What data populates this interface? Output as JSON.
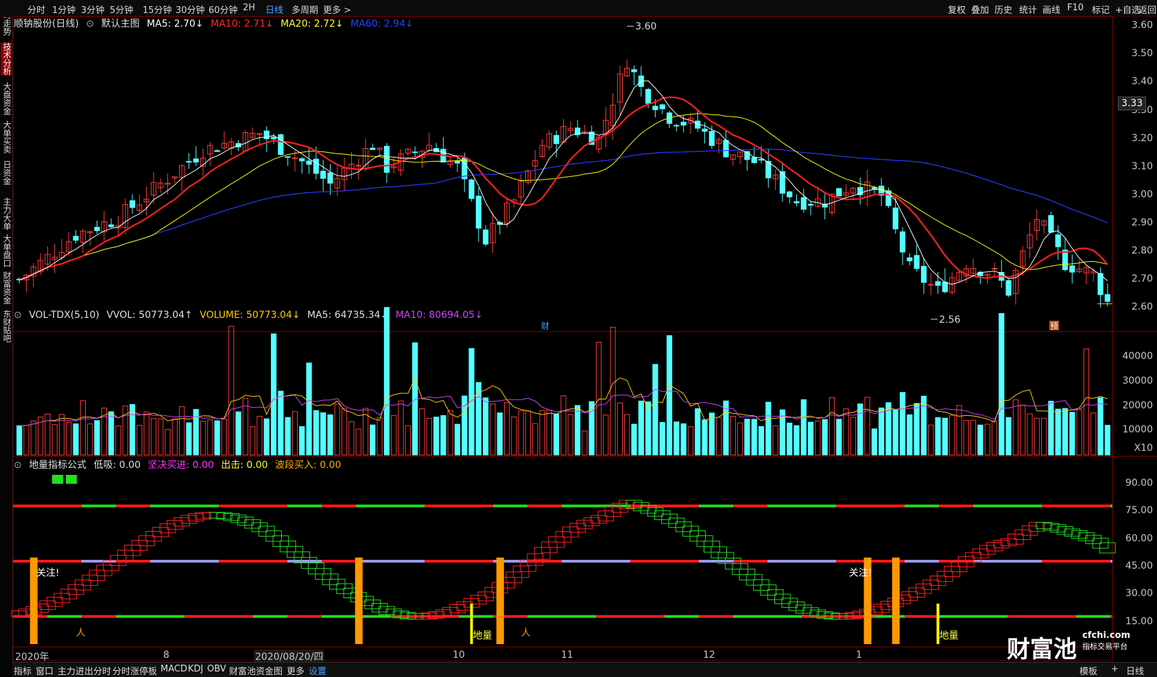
{
  "left_tabs": [
    "分时走势",
    "技术分析",
    "大盘资金",
    "大单买卖",
    "日资金",
    "主力大单",
    "大单盘口",
    "财富资金",
    "东财贴吧"
  ],
  "active_left_tab": 1,
  "periods": [
    "分时",
    "1分钟",
    "3分钟",
    "5分钟",
    "15分钟",
    "30分钟",
    "60分钟",
    "2H",
    "日线",
    "多周期",
    "更多 >"
  ],
  "active_period": "日线",
  "right_tools": [
    "复权",
    "叠加",
    "历史",
    "统计",
    "画线",
    "F10",
    "标记",
    "+自选",
    "返回"
  ],
  "stock": {
    "name": "顺钠股份(日线)",
    "main_chart": "默认主图"
  },
  "ma": {
    "ma5": {
      "label": "MA5: 2.70↓",
      "color": "#ffffff"
    },
    "ma10": {
      "label": "MA10: 2.71↓",
      "color": "#ff2020"
    },
    "ma20": {
      "label": "MA20: 2.72↓",
      "color": "#ffff00"
    },
    "ma60": {
      "label": "MA60: 2.94↓",
      "color": "#2a3cff"
    }
  },
  "price_axis": [
    "3.60",
    "3.50",
    "3.40",
    "3.30",
    "3.20",
    "3.10",
    "3.00",
    "2.90",
    "2.80",
    "2.70",
    "2.60"
  ],
  "last_price": "3.33",
  "high_label": "3.60",
  "low_label": "2.56",
  "markers": {
    "cai": "财",
    "yu": "预"
  },
  "volume": {
    "title": "VOL-TDX(5,10)",
    "vvol": "VVOL: 50773.04↑",
    "volume": "VOLUME: 50773.04↓",
    "ma5": "MA5: 64735.34↓",
    "ma10": "MA10: 80694.05↓",
    "axis": [
      "40000",
      "30000",
      "20000",
      "10000"
    ],
    "unit": "X10"
  },
  "indicator": {
    "title": "地量指标公式",
    "dixi": "低吸: 0.00",
    "jianjue": "坚决买进: 0.00",
    "chuji": "出击: 0.00",
    "boduan": "波段买入: 0.00",
    "axis": [
      "90.00",
      "75.00",
      "60.00",
      "45.00",
      "30.00",
      "15.00"
    ],
    "attention": "关注!",
    "diliang": "地量"
  },
  "dates": [
    {
      "label": "2020年",
      "x": 22
    },
    {
      "label": "8",
      "x": 238
    },
    {
      "label": "2020/08/20/四",
      "x": 370
    },
    {
      "label": "10",
      "x": 660
    },
    {
      "label": "11",
      "x": 818
    },
    {
      "label": "12",
      "x": 1025
    },
    {
      "label": "1",
      "x": 1248
    }
  ],
  "bottom_tabs": [
    "指标",
    "窗口",
    "主力进出分时",
    "分时涨停板",
    "MACD",
    "KDJ",
    "OBV",
    "财富池资金图",
    "更多",
    "设置"
  ],
  "bottom_active": "设置",
  "bottom_right": [
    "模板",
    "+",
    "日线"
  ],
  "watermark": {
    "brand": "财富池",
    "url": "cfchi.com",
    "slogan": "指标交易平台"
  },
  "chart_data": {
    "type": "candlestick",
    "ylim": [
      2.55,
      3.62
    ],
    "series_note": "daily OHLC, approx 137 sessions",
    "key_points": [
      {
        "x": "start",
        "close": 2.7
      },
      {
        "x": "2020-08",
        "close": 3.2
      },
      {
        "x": "2020-10",
        "close": 2.86
      },
      {
        "x": "2020-11",
        "high": 3.6
      },
      {
        "x": "2021-01",
        "close": 3.0
      },
      {
        "x": "end",
        "low": 2.56,
        "close": 2.62
      }
    ]
  }
}
